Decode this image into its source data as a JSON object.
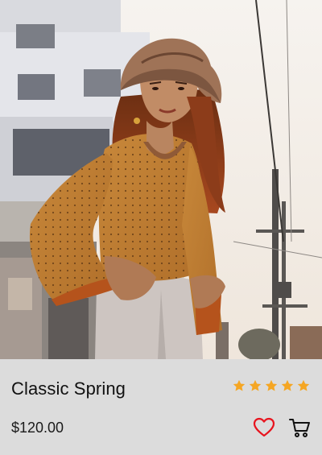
{
  "product": {
    "title": "Classic Spring",
    "price": "$120.00",
    "rating": {
      "value": 5,
      "max": 5
    },
    "image_icon": "photo-of-woman-in-bucket-hat"
  },
  "actions": {
    "favorite_icon": "heart-icon",
    "cart_icon": "cart-icon"
  },
  "colors": {
    "star": "#f5a623",
    "heart": "#e8141e",
    "cart": "#111111",
    "info_bg": "#dcdcdc"
  }
}
